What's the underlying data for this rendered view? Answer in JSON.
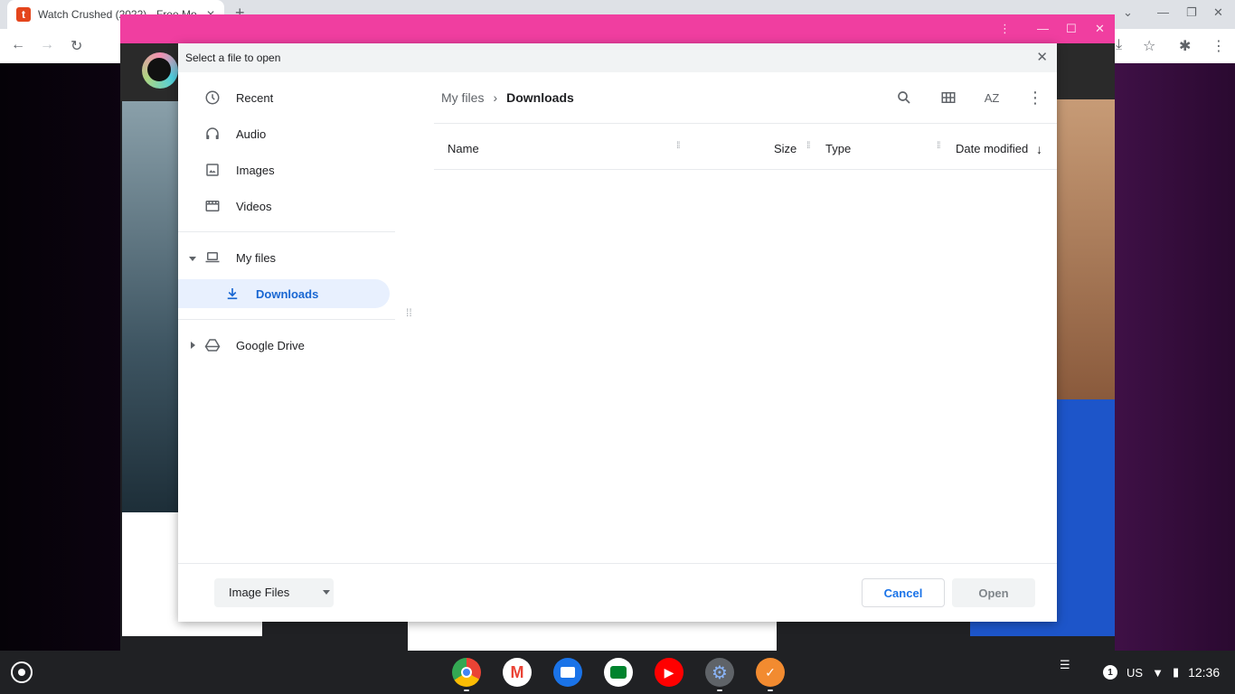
{
  "browser": {
    "tab_title": "Watch Crushed (2022) - Free Mo",
    "tab_favicon": "t"
  },
  "dialog": {
    "title": "Select a file to open",
    "nav": {
      "recent": "Recent",
      "audio": "Audio",
      "images": "Images",
      "videos": "Videos",
      "my_files": "My files",
      "downloads": "Downloads",
      "google_drive": "Google Drive"
    },
    "breadcrumb": [
      "My files",
      "Downloads"
    ],
    "columns": {
      "name": "Name",
      "size": "Size",
      "type": "Type",
      "date_modified": "Date modified"
    },
    "sort_icon_label": "AZ",
    "file_type_select": "Image Files",
    "cancel_label": "Cancel",
    "open_label": "Open"
  },
  "shelf": {
    "apps": [
      "chrome",
      "gmail",
      "files",
      "meet",
      "youtube",
      "settings",
      "notes"
    ],
    "notification_count": "1",
    "keyboard_layout": "US",
    "time": "12:36"
  }
}
